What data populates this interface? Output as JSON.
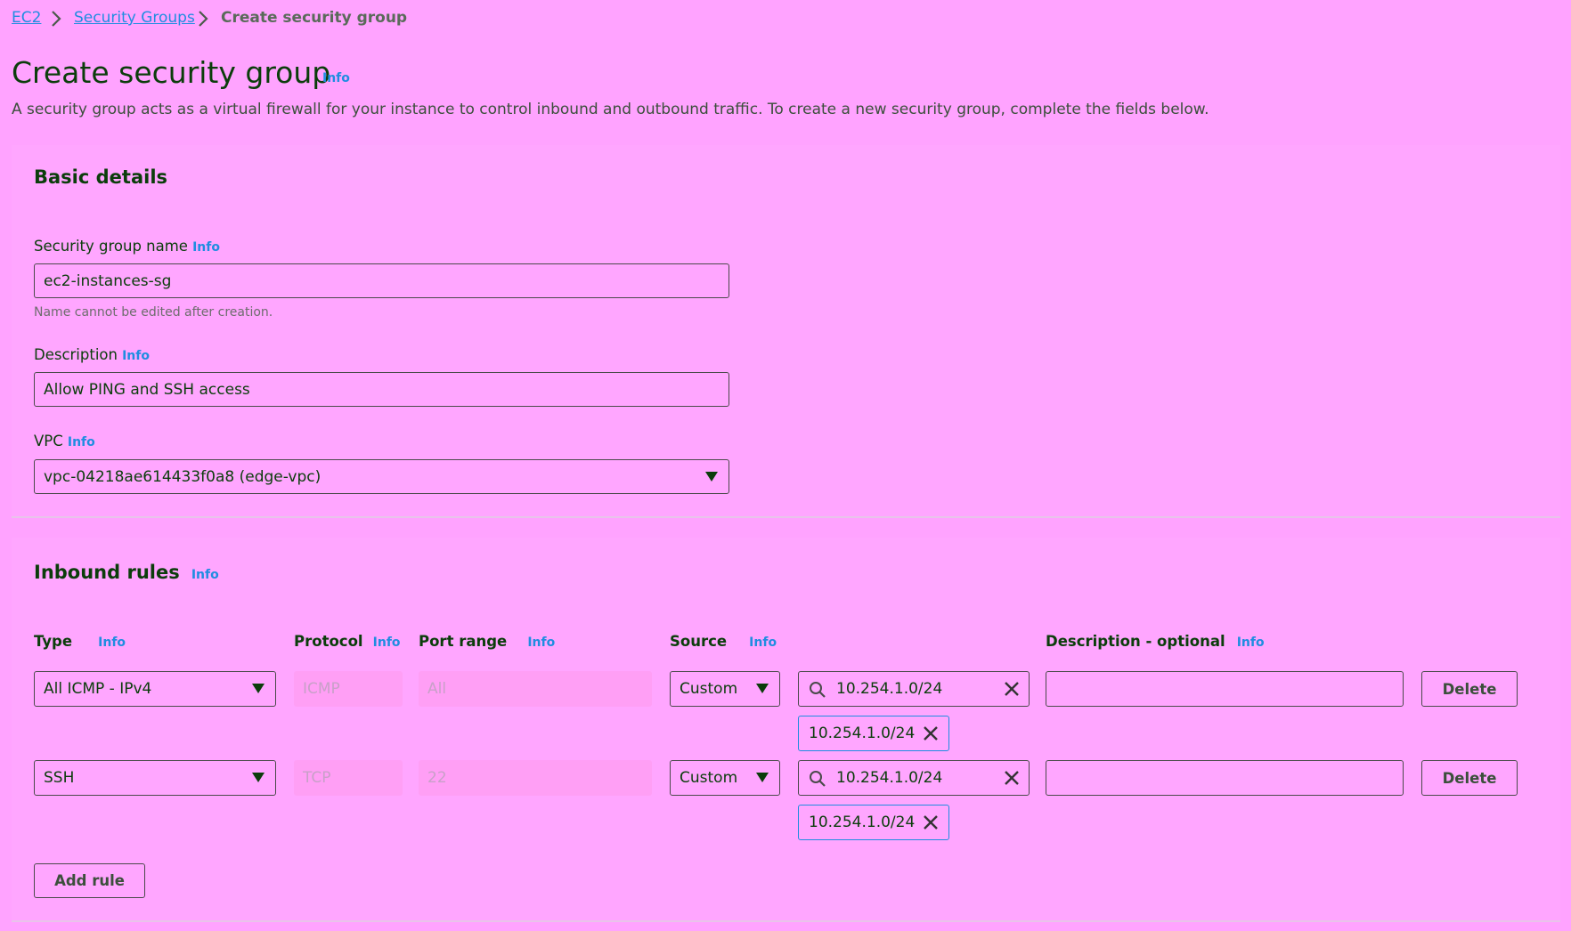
{
  "breadcrumb": {
    "items": [
      "EC2",
      "Security Groups"
    ],
    "current": "Create security group"
  },
  "page": {
    "title": "Create security group",
    "info": "Info",
    "subtitle": "A security group acts as a virtual firewall for your instance to control inbound and outbound traffic. To create a new security group, complete the fields below."
  },
  "basic_details": {
    "title": "Basic details",
    "name_label": "Security group name",
    "name_info": "Info",
    "name_value": "ec2-instances-sg",
    "name_hint": "Name cannot be edited after creation.",
    "description_label": "Description",
    "description_info": "Info",
    "description_value": "Allow PING and SSH access",
    "vpc_label": "VPC",
    "vpc_info": "Info",
    "vpc_value": "vpc-04218ae614433f0a8 (edge-vpc)"
  },
  "inbound": {
    "title": "Inbound rules",
    "info": "Info",
    "columns": {
      "type": "Type",
      "protocol": "Protocol",
      "port_range": "Port range",
      "source": "Source",
      "description": "Description - optional",
      "info": "Info"
    },
    "rules": [
      {
        "type": "All ICMP - IPv4",
        "protocol": "ICMP",
        "port_range": "All",
        "source_type": "Custom",
        "source_search": "10.254.1.0/24",
        "source_token": "10.254.1.0/24",
        "description": "",
        "delete_label": "Delete"
      },
      {
        "type": "SSH",
        "protocol": "TCP",
        "port_range": "22",
        "source_type": "Custom",
        "source_search": "10.254.1.0/24",
        "source_token": "10.254.1.0/24",
        "description": "",
        "delete_label": "Delete"
      }
    ],
    "add_rule_label": "Add rule"
  },
  "colors": {
    "background": "#ffa3ff",
    "heading": "#0b3d0b",
    "link": "#1f8de0"
  }
}
